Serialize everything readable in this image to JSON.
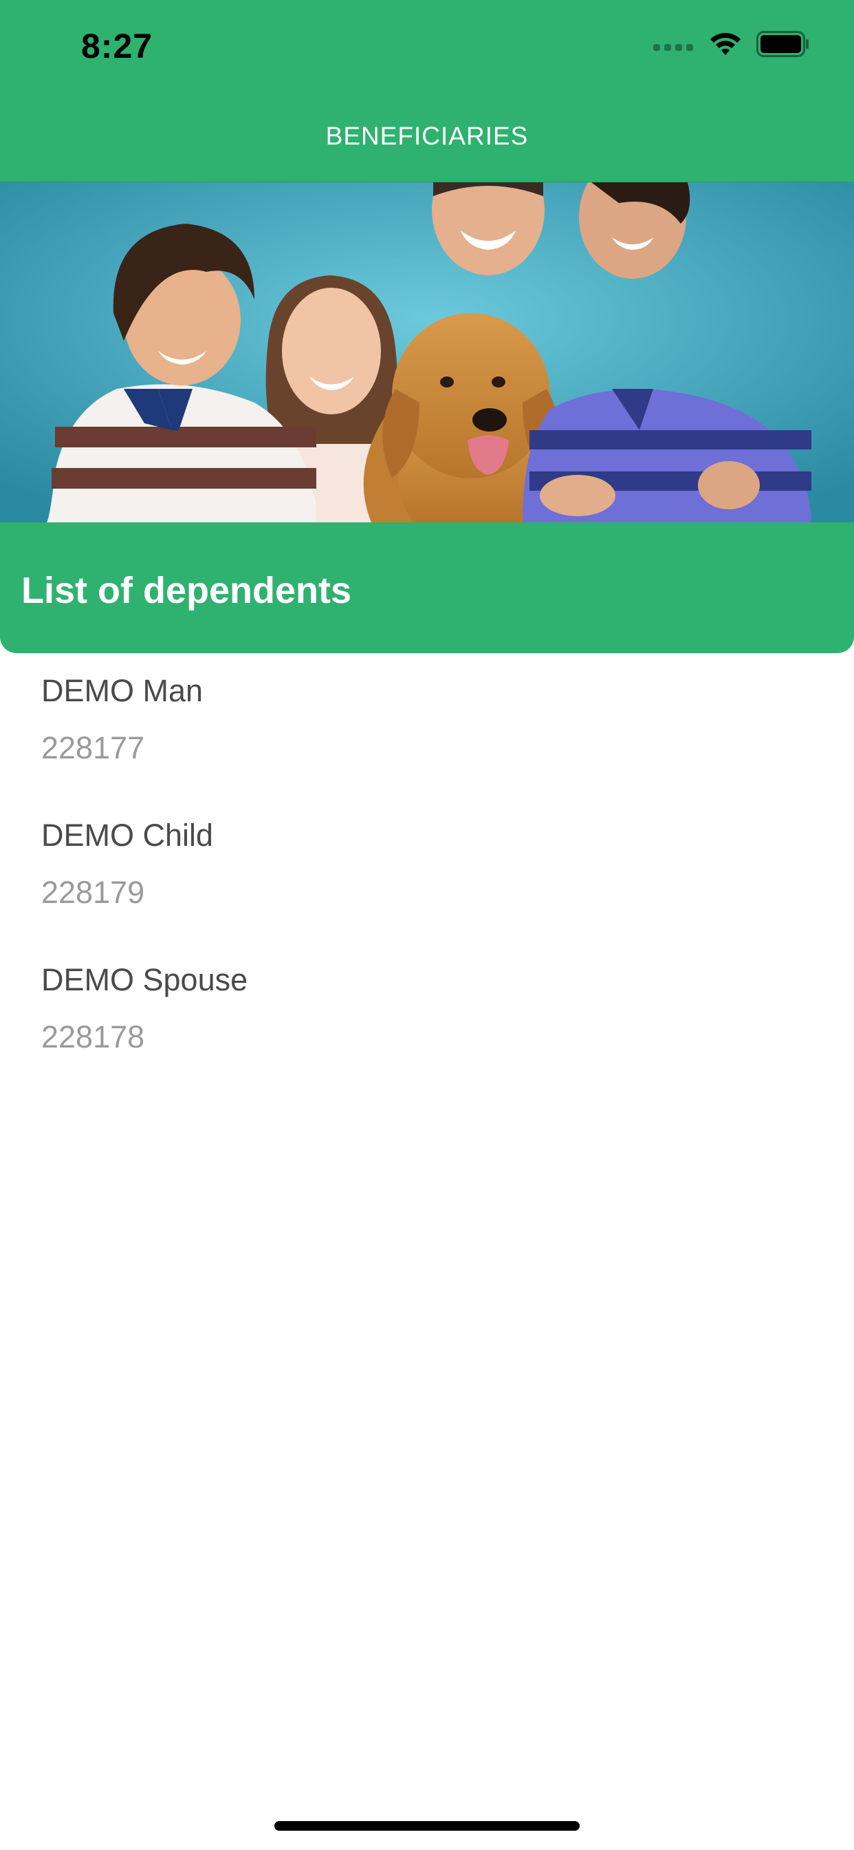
{
  "status_bar": {
    "time": "8:27",
    "icons": [
      "cellular-signal-icon",
      "wifi-icon",
      "battery-icon"
    ]
  },
  "nav": {
    "title": "BENEFICIARIES"
  },
  "hero": {
    "image": "family-with-dog-photo"
  },
  "list": {
    "title": "List of dependents",
    "items": [
      {
        "name": "DEMO Man",
        "id": "228177"
      },
      {
        "name": "DEMO Child",
        "id": "228179"
      },
      {
        "name": "DEMO Spouse",
        "id": "228178"
      }
    ]
  },
  "colors": {
    "brand_green": "#2fb170",
    "name_text": "#4a4a4a",
    "id_text": "#9a9a9a"
  }
}
